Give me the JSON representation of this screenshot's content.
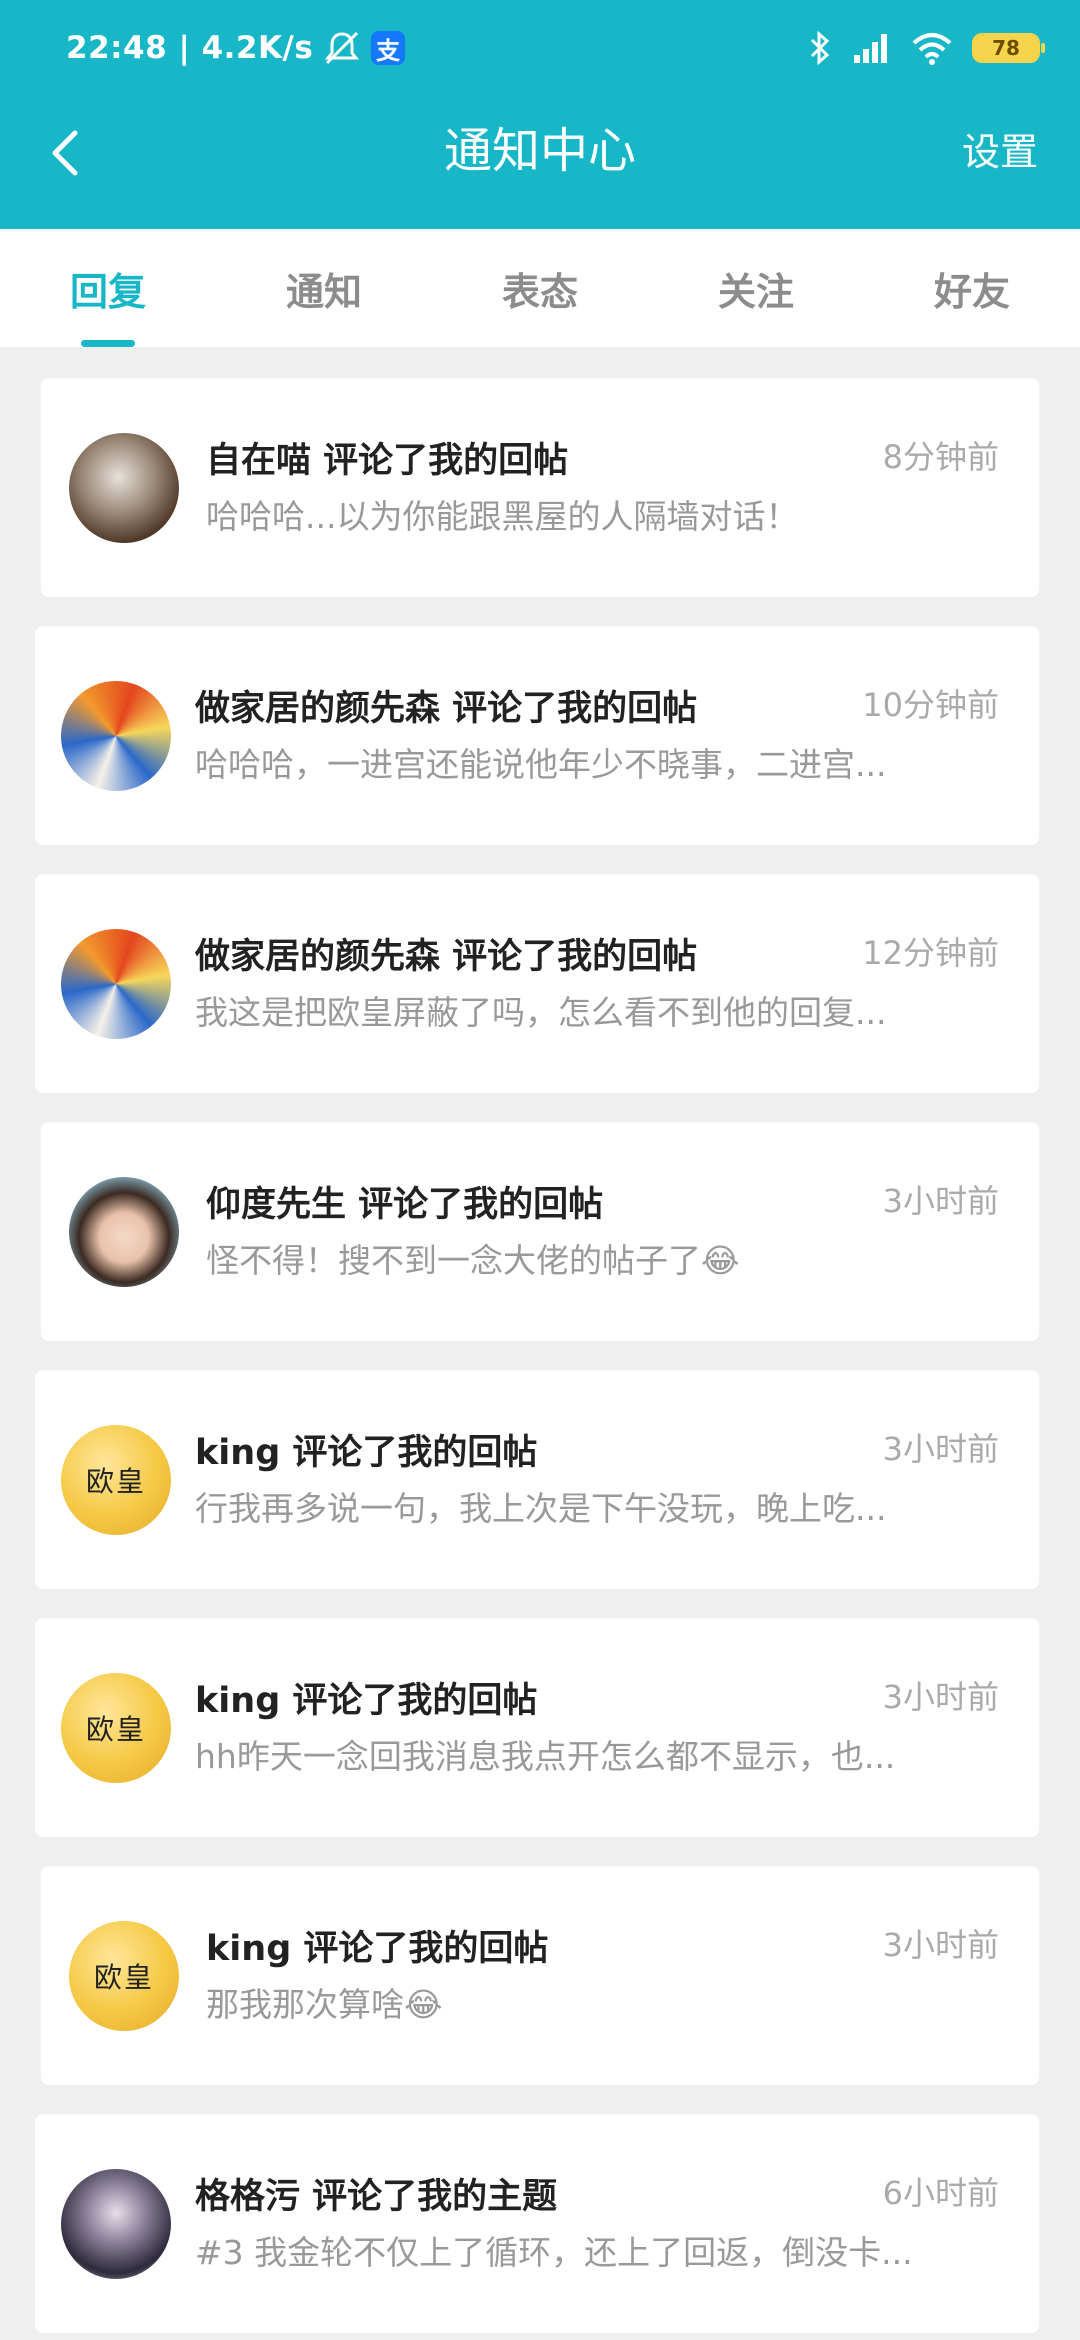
{
  "status_bar": {
    "time_speed": "22:48 | 4.2K/s",
    "alipay_icon_char": "支",
    "battery_level": "78"
  },
  "header": {
    "title": "通知中心",
    "settings_label": "设置"
  },
  "tabs": [
    {
      "label": "回复",
      "active": true
    },
    {
      "label": "通知",
      "active": false
    },
    {
      "label": "表态",
      "active": false
    },
    {
      "label": "关注",
      "active": false
    },
    {
      "label": "好友",
      "active": false
    }
  ],
  "notifications": [
    {
      "title": "自在喵 评论了我的回帖",
      "time": "8分钟前",
      "preview": "哈哈哈...以为你能跟黑屋的人隔墙对话！",
      "avatar": "cat-photo"
    },
    {
      "title": "做家居的颜先森 评论了我的回帖",
      "time": "10分钟前",
      "preview": "哈哈哈，一进宫还能说他年少不晓事，二进宫...",
      "avatar": "swirl-art"
    },
    {
      "title": "做家居的颜先森 评论了我的回帖",
      "time": "12分钟前",
      "preview": "我这是把欧皇屏蔽了吗，怎么看不到他的回复...",
      "avatar": "swirl-art"
    },
    {
      "title": "仰度先生 评论了我的回帖",
      "time": "3小时前",
      "preview": "怪不得！搜不到一念大佬的帖子了😂",
      "avatar": "girl-photo"
    },
    {
      "title": "king 评论了我的回帖",
      "time": "3小时前",
      "preview": "行我再多说一句，我上次是下午没玩，晚上吃...",
      "avatar": "gold-badge",
      "avatar_text": "欧皇"
    },
    {
      "title": "king 评论了我的回帖",
      "time": "3小时前",
      "preview": "hh昨天一念回我消息我点开怎么都不显示，也...",
      "avatar": "gold-badge",
      "avatar_text": "欧皇"
    },
    {
      "title": "king 评论了我的回帖",
      "time": "3小时前",
      "preview": "那我那次算啥😂",
      "avatar": "gold-badge",
      "avatar_text": "欧皇"
    },
    {
      "title": "格格污 评论了我的主题",
      "time": "6小时前",
      "preview": "#3 我金轮不仅上了循环，还上了回返，倒没卡...",
      "avatar": "anime-art"
    }
  ],
  "colors": {
    "accent": "#17b7c8",
    "background": "#efefef",
    "muted_text": "#999999"
  }
}
